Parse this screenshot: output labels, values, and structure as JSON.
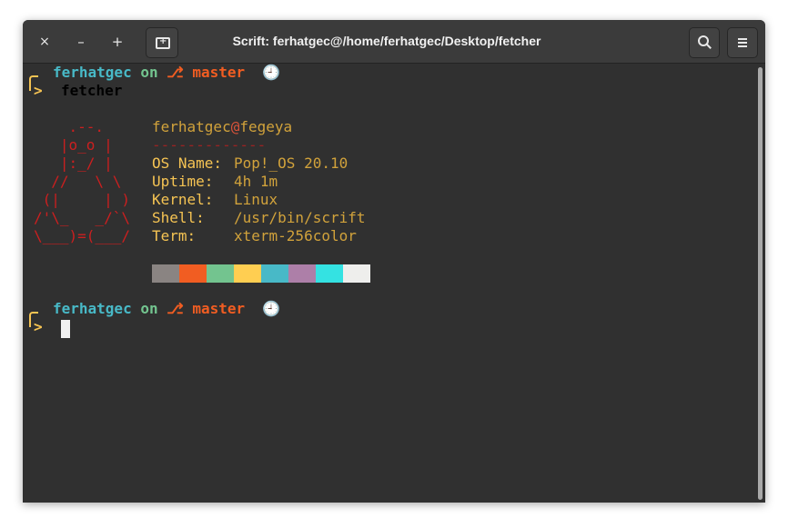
{
  "window": {
    "title": "Scrift: ferhatgec@/home/ferhatgec/Desktop/fetcher",
    "close_glyph": "×",
    "minimize_glyph": "–",
    "maximize_glyph": "+",
    "icons": [
      "close-icon",
      "minimize-icon",
      "maximize-icon",
      "new-tab-icon",
      "search-icon",
      "hamburger-menu-icon"
    ]
  },
  "prompt1": {
    "user": "ferhatgec",
    "on": "on",
    "branch_glyph": "⎇",
    "branch": "master",
    "clock": "🕘",
    "arrow": ">",
    "command": "fetcher"
  },
  "ascii_art": [
    "    .--.",
    "   |o_o |",
    "   |:_/ |",
    "  //   \\ \\",
    " (|     | )",
    "/'\\_   _/`\\",
    "\\___)=(___/"
  ],
  "fetch": {
    "user": "ferhatgec",
    "at": "@",
    "host": "fegeya",
    "separator": "-------------",
    "rows": [
      {
        "key": "OS Name:",
        "value": "Pop!_OS 20.10"
      },
      {
        "key": "Uptime:",
        "value": "4h 1m"
      },
      {
        "key": "Kernel:",
        "value": "Linux"
      },
      {
        "key": "Shell:",
        "value": "/usr/bin/scrift"
      },
      {
        "key": "Term:",
        "value": "xterm-256color"
      }
    ]
  },
  "palette": [
    "#8a8482",
    "#f15d22",
    "#73c48f",
    "#ffce51",
    "#48b9c7",
    "#ad7fa8",
    "#34e2e2",
    "#eeeeec"
  ],
  "prompt2": {
    "user": "ferhatgec",
    "on": "on",
    "branch_glyph": "⎇",
    "branch": "master",
    "clock": "🕘",
    "arrow": ">"
  }
}
